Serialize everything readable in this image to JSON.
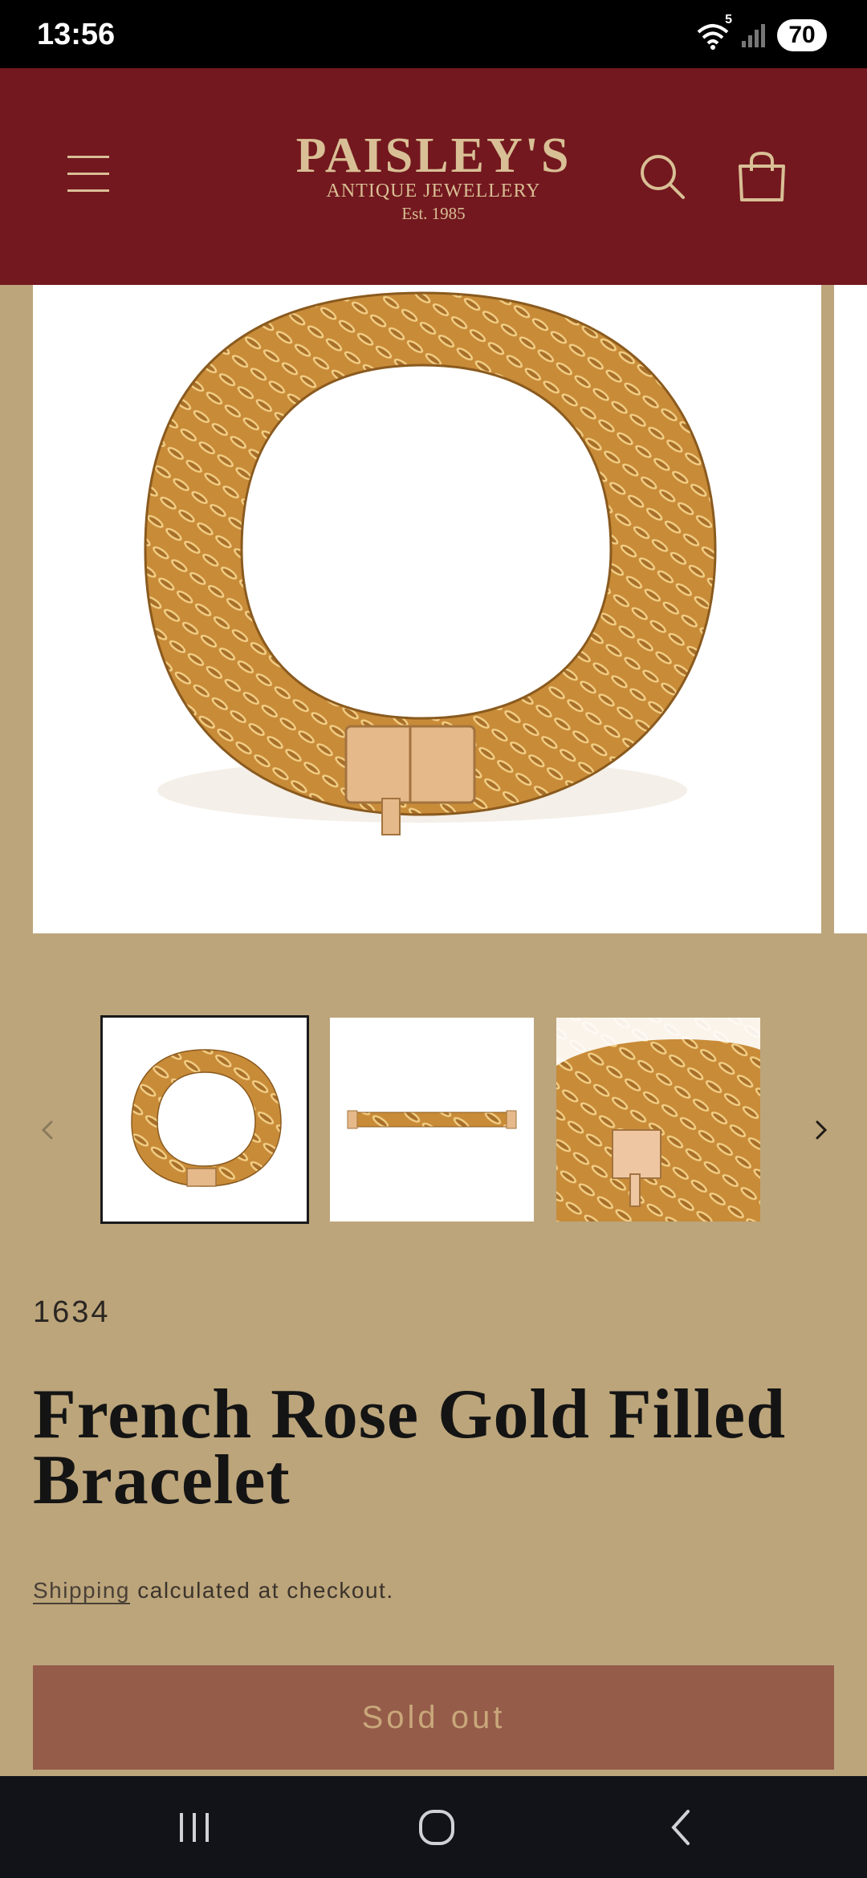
{
  "status_bar": {
    "time": "13:56",
    "wifi_badge": "5",
    "battery": "70",
    "icons": [
      "wifi-icon",
      "signal-icon",
      "battery-icon"
    ]
  },
  "header": {
    "logo": {
      "main": "PAISLEY'S",
      "sub": "ANTIQUE JEWELLERY",
      "est": "Est. 1985"
    },
    "icons": [
      "menu-icon",
      "search-icon",
      "cart-icon"
    ]
  },
  "gallery": {
    "thumbnails": [
      "bracelet-round-view",
      "bracelet-flat-view",
      "bracelet-clasp-closeup"
    ],
    "active_thumbnail": 0,
    "icons": [
      "chevron-left-icon",
      "chevron-right-icon"
    ]
  },
  "product": {
    "sku": "1634",
    "title": "French Rose Gold Filled Bracelet",
    "shipping_link": "Shipping",
    "shipping_suffix": " calculated at checkout.",
    "button_label": "Sold out"
  },
  "nav_bar": {
    "icons": [
      "recent-apps-icon",
      "home-icon",
      "back-icon"
    ]
  },
  "colors": {
    "page_bg": "#bca57b",
    "header_bg": "#73181f",
    "logo": "#d9bf95",
    "button_bg": "#955c4a",
    "button_text": "#c9a77a"
  }
}
